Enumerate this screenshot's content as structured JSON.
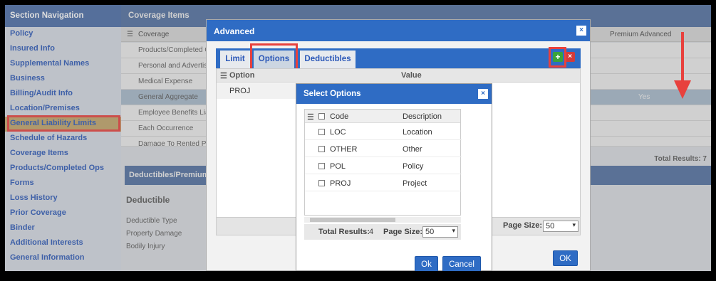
{
  "sidebar": {
    "title": "Section Navigation",
    "items": [
      {
        "label": "Policy"
      },
      {
        "label": "Insured Info"
      },
      {
        "label": "Supplemental Names"
      },
      {
        "label": "Business"
      },
      {
        "label": "Billing/Audit Info"
      },
      {
        "label": "Location/Premises"
      },
      {
        "label": "General Liability Limits"
      },
      {
        "label": "Schedule of Hazards"
      },
      {
        "label": "Coverage Items"
      },
      {
        "label": "Products/Completed Ops"
      },
      {
        "label": "Forms"
      },
      {
        "label": "Loss History"
      },
      {
        "label": "Prior Coverage"
      },
      {
        "label": "Binder"
      },
      {
        "label": "Additional Interests"
      },
      {
        "label": "General Information"
      }
    ]
  },
  "coverage": {
    "title": "Coverage Items",
    "columns": {
      "coverage": "Coverage",
      "premium": "Premium",
      "advanced": "Advanced"
    },
    "rows": [
      {
        "label": "Products/Completed Op"
      },
      {
        "label": "Personal and Advertising"
      },
      {
        "label": "Medical Expense"
      },
      {
        "label": "General Aggregate",
        "advanced": "Yes"
      },
      {
        "label": "Employee Benefits Liabi"
      },
      {
        "label": "Each Occurrence"
      },
      {
        "label": "Damage To Rented Prem"
      }
    ],
    "total_results": "Total Results: 7"
  },
  "deductibles": {
    "title": "Deductibles/Premiums",
    "section_title": "Deductible",
    "fields": [
      "Deductible Type",
      "Property Damage",
      "Bodily Injury"
    ]
  },
  "advanced_modal": {
    "title": "Advanced",
    "close_icon": "×",
    "tabs": [
      "Limit",
      "Options",
      "Deductibles"
    ],
    "add_icon": "+",
    "delete_icon": "×",
    "columns": {
      "option": "Option",
      "value": "Value"
    },
    "rows": [
      {
        "option": "PROJ"
      }
    ],
    "page_size_label": "Page Size:",
    "page_size": "50",
    "ok_label": "OK"
  },
  "select_modal": {
    "title": "Select Options",
    "close_icon": "×",
    "columns": {
      "code": "Code",
      "description": "Description"
    },
    "rows": [
      {
        "code": "LOC",
        "description": "Location"
      },
      {
        "code": "OTHER",
        "description": "Other"
      },
      {
        "code": "POL",
        "description": "Policy"
      },
      {
        "code": "PROJ",
        "description": "Project"
      }
    ],
    "total_results_label": "Total Results:",
    "total_results": "4",
    "page_size_label": "Page Size:",
    "page_size": "50",
    "ok_label": "Ok",
    "cancel_label": "Cancel"
  },
  "colors": {
    "header_blue": "#4a6da7",
    "modal_blue": "#2f6cc4",
    "link_blue": "#2b58b8",
    "highlight_red": "#e8413d",
    "active_nav": "#c2a469"
  }
}
